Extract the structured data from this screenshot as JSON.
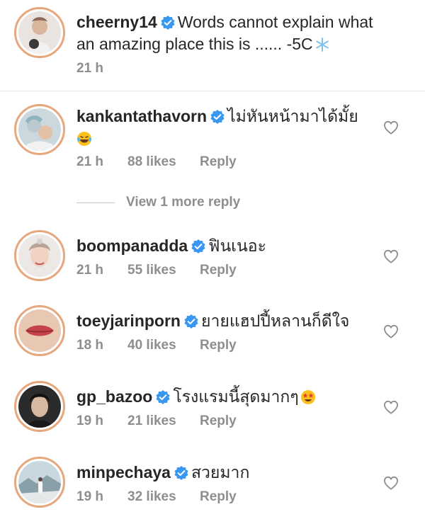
{
  "caption": {
    "username": "cheerny14",
    "text": "Words cannot explain what an amazing place this is ...... -5C",
    "emoji": "snowflake-emoji",
    "time": "21 h"
  },
  "comments": [
    {
      "username": "kankantathavorn",
      "text": "ไม่หันหน้ามาได้มั้ย",
      "emoji": "laughing-tears-emoji",
      "time": "21 h",
      "likes": "88 likes",
      "reply": "Reply"
    },
    {
      "username": "boompanadda",
      "text": "ฟินเนอะ",
      "time": "21 h",
      "likes": "55 likes",
      "reply": "Reply"
    },
    {
      "username": "toeyjarinporn",
      "text": "ยายแฮปปี้หลานก็ดีใจ",
      "time": "18 h",
      "likes": "40 likes",
      "reply": "Reply"
    },
    {
      "username": "gp_bazoo",
      "text": "โรงแรมนี้สุดมากๆ",
      "emoji": "star-struck-emoji",
      "time": "19 h",
      "likes": "21 likes",
      "reply": "Reply"
    },
    {
      "username": "minpechaya",
      "text": "สวยมาก",
      "time": "19 h",
      "likes": "32 likes",
      "reply": "Reply"
    }
  ],
  "view_more": "View 1 more reply",
  "colors": {
    "verified": "#3897f0",
    "meta_gray": "#8e8e8e",
    "text": "#262626",
    "story_ring": "#e7a77c"
  }
}
